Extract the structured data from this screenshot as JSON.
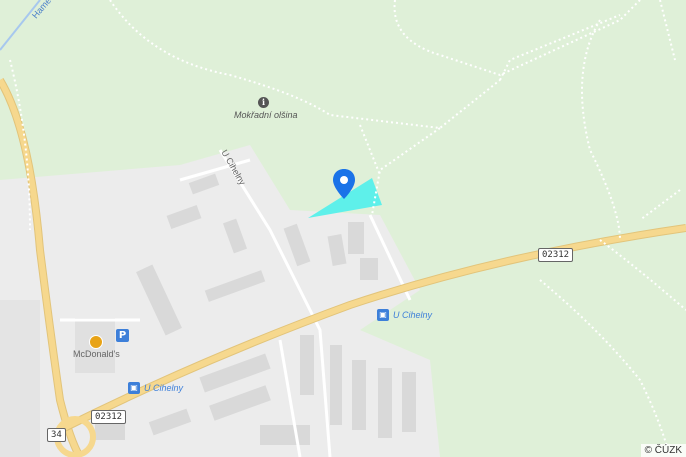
{
  "map": {
    "labels": {
      "poi_name": "Mokřadní olšina",
      "street": "U Cihelny",
      "street_top": "Hame",
      "restaurant": "McDonald's"
    },
    "bus_stops": [
      {
        "label": "U Cihelny"
      },
      {
        "label": "U Cihelny"
      }
    ],
    "route_shields": {
      "r1": "02312",
      "r2": "02312",
      "r3": "34"
    },
    "icons": {
      "poi": "info-poi-icon",
      "parking": "parking-icon",
      "bus": "bus-stop-icon",
      "pin": "location-pin-icon",
      "restaurant": "restaurant-icon"
    },
    "parking_symbol": "P",
    "poi_symbol": "i",
    "bus_symbol": "▣",
    "copyright": "© ČÚZK",
    "colors": {
      "forest": "#dff0d8",
      "urban": "#ececec",
      "road_main": "#f6d88e",
      "highlight": "#5ef0ea",
      "pin": "#1a73e8"
    }
  }
}
